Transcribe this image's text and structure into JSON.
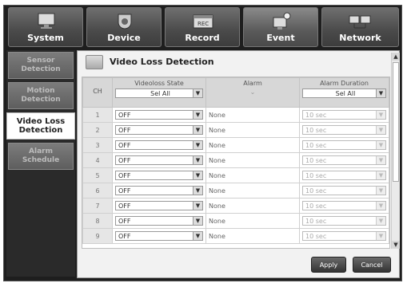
{
  "tabs": [
    {
      "label": "System",
      "icon": "monitor-icon"
    },
    {
      "label": "Device",
      "icon": "camera-icon"
    },
    {
      "label": "Record",
      "icon": "record-icon"
    },
    {
      "label": "Event",
      "icon": "event-camera-icon"
    },
    {
      "label": "Network",
      "icon": "network-icon"
    }
  ],
  "sidebar": [
    {
      "label1": "Sensor",
      "label2": "Detection"
    },
    {
      "label1": "Motion",
      "label2": "Detection"
    },
    {
      "label1": "Video Loss",
      "label2": "Detection"
    },
    {
      "label1": "Alarm",
      "label2": "Schedule"
    }
  ],
  "page_title": "Video Loss Detection",
  "table": {
    "headers": {
      "ch": "CH",
      "state": "Videoloss State",
      "alarm": "Alarm",
      "duration": "Alarm Duration"
    },
    "sel_all": {
      "state": "Sel All",
      "duration": "Sel All"
    },
    "rows": [
      {
        "ch": "1",
        "state": "OFF",
        "alarm": "None",
        "duration": "10 sec"
      },
      {
        "ch": "2",
        "state": "OFF",
        "alarm": "None",
        "duration": "10 sec"
      },
      {
        "ch": "3",
        "state": "OFF",
        "alarm": "None",
        "duration": "10 sec"
      },
      {
        "ch": "4",
        "state": "OFF",
        "alarm": "None",
        "duration": "10 sec"
      },
      {
        "ch": "5",
        "state": "OFF",
        "alarm": "None",
        "duration": "10 sec"
      },
      {
        "ch": "6",
        "state": "OFF",
        "alarm": "None",
        "duration": "10 sec"
      },
      {
        "ch": "7",
        "state": "OFF",
        "alarm": "None",
        "duration": "10 sec"
      },
      {
        "ch": "8",
        "state": "OFF",
        "alarm": "None",
        "duration": "10 sec"
      },
      {
        "ch": "9",
        "state": "OFF",
        "alarm": "None",
        "duration": "10 sec"
      }
    ]
  },
  "buttons": {
    "apply": "Apply",
    "cancel": "Cancel"
  }
}
